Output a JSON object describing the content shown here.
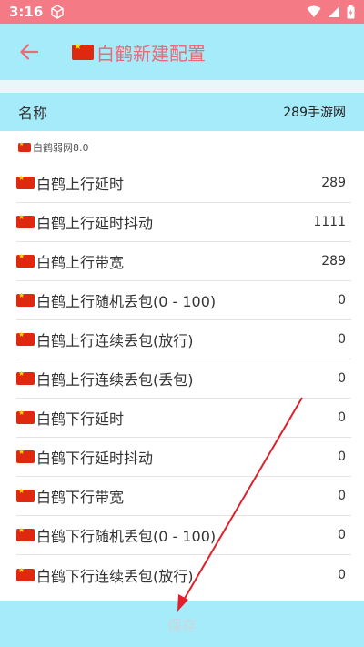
{
  "status_bar": {
    "time": "3:16"
  },
  "app_bar": {
    "title": "白鹤新建配置"
  },
  "name_field": {
    "label": "名称",
    "value": "289手游网"
  },
  "section": {
    "title": "白鹤弱网8.0"
  },
  "settings": [
    {
      "label": "白鹤上行延时",
      "value": "289"
    },
    {
      "label": "白鹤上行延时抖动",
      "value": "1111"
    },
    {
      "label": "白鹤上行带宽",
      "value": "289"
    },
    {
      "label": "白鹤上行随机丢包(0 - 100)",
      "value": "0"
    },
    {
      "label": "白鹤上行连续丢包(放行)",
      "value": "0"
    },
    {
      "label": "白鹤上行连续丢包(丢包)",
      "value": "0"
    },
    {
      "label": "白鹤下行延时",
      "value": "0"
    },
    {
      "label": "白鹤下行延时抖动",
      "value": "0"
    },
    {
      "label": "白鹤下行带宽",
      "value": "0"
    },
    {
      "label": "白鹤下行随机丢包(0 - 100)",
      "value": "0"
    },
    {
      "label": "白鹤下行连续丢包(放行)",
      "value": "0"
    }
  ],
  "save": {
    "label": "保存"
  },
  "colors": {
    "status_bar": "#f47a86",
    "app_bar": "#a6ebfa",
    "accent": "#e96a78",
    "annotation_arrow": "#e0202a"
  }
}
